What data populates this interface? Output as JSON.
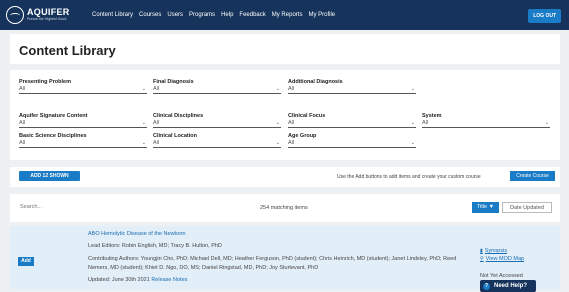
{
  "header": {
    "logo_name": "AQUIFER",
    "logo_tagline": "Pursue the Highest Good",
    "nav": [
      "Content Library",
      "Courses",
      "Users",
      "Programs",
      "Help",
      "Feedback",
      "My Reports",
      "My Profile"
    ],
    "logout_label": "LOG OUT"
  },
  "page_title": "Content Library",
  "filters": {
    "presenting_problem": {
      "label": "Presenting Problem",
      "value": "All"
    },
    "final_diagnosis": {
      "label": "Final Diagnosis",
      "value": "All"
    },
    "additional_diagnosis": {
      "label": "Additional Diagnosis",
      "value": "All"
    },
    "signature_content": {
      "label": "Aquifer Signature Content",
      "value": "All"
    },
    "clinical_disciplines": {
      "label": "Clinical Disciplines",
      "value": "All"
    },
    "clinical_focus": {
      "label": "Clinical Focus",
      "value": "All"
    },
    "system": {
      "label": "System",
      "value": "All"
    },
    "basic_science": {
      "label": "Basic Science Disciplines",
      "value": "All"
    },
    "clinical_location": {
      "label": "Clinical Location",
      "value": "All"
    },
    "age_group": {
      "label": "Age Group",
      "value": "All"
    }
  },
  "actions": {
    "add_shown_label": "ADD 12 SHOWN",
    "help_text": "Use the Add buttons to add items and create your custom course",
    "create_course_label": "Create Course"
  },
  "search": {
    "placeholder": "Search...",
    "match_count": "254 matching items",
    "sort_title_label": "Title ▼",
    "sort_date_label": "Date Updated"
  },
  "result": {
    "add_label": "Add",
    "title": "ABO Hemolytic Disease of the Newborn",
    "lead_editors": "Lead Editors: Robin English, MD; Tracy B. Hulton, PhD",
    "contributors": "Contributing Authors: Youngjin Cho, PhD; Michael Dell, MD; Heather Ferguson, PhD (student); Chris Heinrich, MD (student); Janet Lindsley, PhD; Reed Nemers, MD (student); Khiet D. Ngo, DO, MS; Daniel Ringstad, MD, PhD; Joy Sturtevant, PhD",
    "updated": "Updated: June 30th 2021",
    "release_notes": "Release Notes",
    "synopsis_label": "Synopsis",
    "mod_label": "View MOD Map",
    "access_status": "Not Yet Accessed"
  },
  "help_widget": {
    "label": "Need Help?"
  }
}
